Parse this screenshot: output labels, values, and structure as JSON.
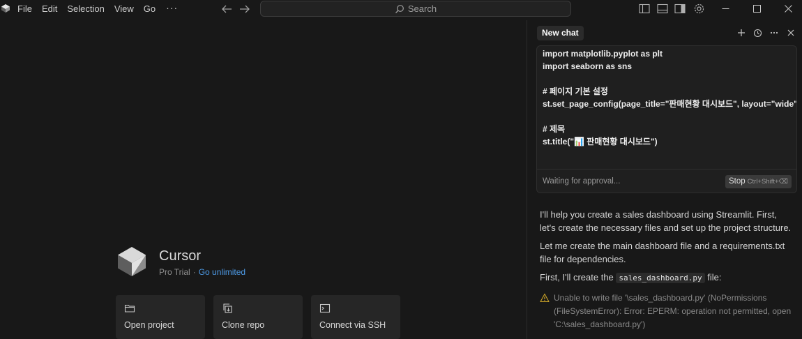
{
  "menu": {
    "items": [
      "File",
      "Edit",
      "Selection",
      "View",
      "Go"
    ],
    "more": "···"
  },
  "search": {
    "label": "Search"
  },
  "welcome": {
    "app_name": "Cursor",
    "plan": "Pro Trial",
    "separator": "·",
    "upgrade_link": "Go unlimited",
    "actions": [
      {
        "label": "Open project",
        "icon": "folder-icon"
      },
      {
        "label": "Clone repo",
        "icon": "clone-icon"
      },
      {
        "label": "Connect via SSH",
        "icon": "terminal-icon"
      }
    ]
  },
  "chat": {
    "tab_label": "New chat",
    "code_lines": [
      "import matplotlib.pyplot as plt",
      "import seaborn as sns",
      "",
      "# 페이지 기본 설정",
      "st.set_page_config(page_title=\"판매현황 대시보드\", layout=\"wide\")",
      "",
      "# 제목",
      "st.title(\"📊 판매현황 대시보드\")"
    ],
    "status": "Waiting for approval...",
    "stop_label": "Stop",
    "stop_shortcut": "Ctrl+Shift+⌫",
    "messages": {
      "m1": "I'll help you create a sales dashboard using Streamlit. First, let's create the necessary files and set up the project structure.",
      "m2": "Let me create the main dashboard file and a requirements.txt file for dependencies.",
      "m3_prefix": "First, I'll create the ",
      "m3_code": "sales_dashboard.py",
      "m3_suffix": " file:"
    },
    "error": "Unable to write file '\\sales_dashboard.py' (NoPermissions (FileSystemError): Error: EPERM: operation not permitted, open 'C:\\sales_dashboard.py')"
  },
  "colors": {
    "link": "#4d9ae6",
    "warning": "#c9a227",
    "background": "#181818"
  }
}
